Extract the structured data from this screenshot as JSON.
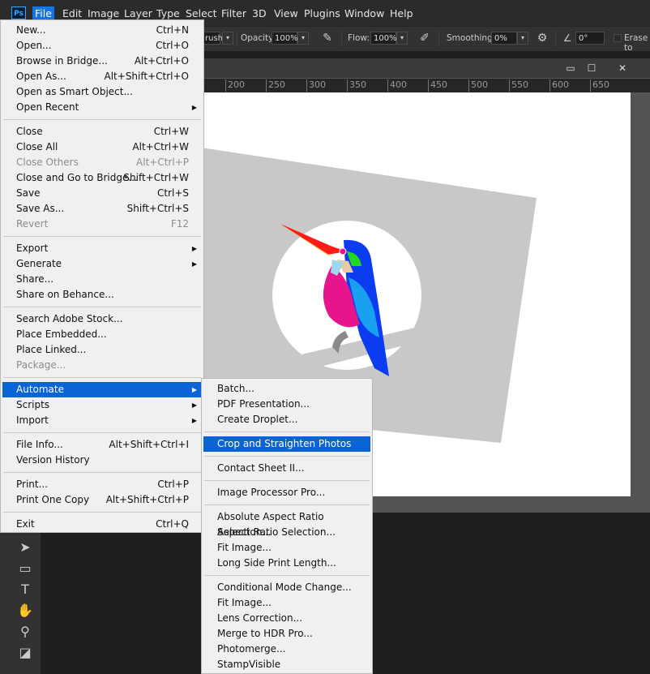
{
  "menubar": {
    "logo": "Ps",
    "menus": [
      "File",
      "Edit",
      "Image",
      "Layer",
      "Type",
      "Select",
      "Filter",
      "3D",
      "View",
      "Plugins",
      "Window",
      "Help"
    ],
    "active_menu": "File"
  },
  "options_bar": {
    "brush_fragment": "rush",
    "opacity_label": "Opacity:",
    "opacity_value": "100%",
    "flow_label": "Flow:",
    "flow_value": "100%",
    "smoothing_label": "Smoothing:",
    "smoothing_value": "0%",
    "angle_value": "0°",
    "erase_label": "Erase to"
  },
  "document_window": {
    "controls": [
      "▭",
      "☐",
      "✕"
    ],
    "ruler_ticks": [
      "200",
      "250",
      "300",
      "350",
      "400",
      "450",
      "500",
      "550",
      "600",
      "650"
    ]
  },
  "file_menu": {
    "groups": [
      [
        {
          "label": "New...",
          "shortcut": "Ctrl+N"
        },
        {
          "label": "Open...",
          "shortcut": "Ctrl+O"
        },
        {
          "label": "Browse in Bridge...",
          "shortcut": "Alt+Ctrl+O"
        },
        {
          "label": "Open As...",
          "shortcut": "Alt+Shift+Ctrl+O"
        },
        {
          "label": "Open as Smart Object...",
          "shortcut": ""
        },
        {
          "label": "Open Recent",
          "shortcut": "",
          "submenu": true
        }
      ],
      [
        {
          "label": "Close",
          "shortcut": "Ctrl+W"
        },
        {
          "label": "Close All",
          "shortcut": "Alt+Ctrl+W"
        },
        {
          "label": "Close Others",
          "shortcut": "Alt+Ctrl+P",
          "disabled": true
        },
        {
          "label": "Close and Go to Bridge...",
          "shortcut": "Shift+Ctrl+W"
        },
        {
          "label": "Save",
          "shortcut": "Ctrl+S"
        },
        {
          "label": "Save As...",
          "shortcut": "Shift+Ctrl+S"
        },
        {
          "label": "Revert",
          "shortcut": "F12",
          "disabled": true
        }
      ],
      [
        {
          "label": "Export",
          "shortcut": "",
          "submenu": true
        },
        {
          "label": "Generate",
          "shortcut": "",
          "submenu": true
        },
        {
          "label": "Share...",
          "shortcut": ""
        },
        {
          "label": "Share on Behance...",
          "shortcut": ""
        }
      ],
      [
        {
          "label": "Search Adobe Stock...",
          "shortcut": ""
        },
        {
          "label": "Place Embedded...",
          "shortcut": ""
        },
        {
          "label": "Place Linked...",
          "shortcut": ""
        },
        {
          "label": "Package...",
          "shortcut": "",
          "disabled": true
        }
      ],
      [
        {
          "label": "Automate",
          "shortcut": "",
          "submenu": true,
          "highlighted": true
        },
        {
          "label": "Scripts",
          "shortcut": "",
          "submenu": true
        },
        {
          "label": "Import",
          "shortcut": "",
          "submenu": true
        }
      ],
      [
        {
          "label": "File Info...",
          "shortcut": "Alt+Shift+Ctrl+I"
        },
        {
          "label": "Version History",
          "shortcut": ""
        }
      ],
      [
        {
          "label": "Print...",
          "shortcut": "Ctrl+P"
        },
        {
          "label": "Print One Copy",
          "shortcut": "Alt+Shift+Ctrl+P"
        }
      ],
      [
        {
          "label": "Exit",
          "shortcut": "Ctrl+Q"
        }
      ]
    ]
  },
  "automate_submenu": {
    "groups": [
      [
        {
          "label": "Batch..."
        },
        {
          "label": "PDF Presentation..."
        },
        {
          "label": "Create Droplet..."
        }
      ],
      [
        {
          "label": "Crop and Straighten Photos",
          "highlighted": true
        }
      ],
      [
        {
          "label": "Contact Sheet II..."
        }
      ],
      [
        {
          "label": "Image Processor Pro..."
        }
      ],
      [
        {
          "label": "Absolute Aspect Ratio Selection..."
        },
        {
          "label": "Aspect Ratio Selection..."
        },
        {
          "label": "Fit Image..."
        },
        {
          "label": "Long Side Print Length..."
        }
      ],
      [
        {
          "label": "Conditional Mode Change..."
        },
        {
          "label": "Fit Image..."
        },
        {
          "label": "Lens Correction..."
        },
        {
          "label": "Merge to HDR Pro..."
        },
        {
          "label": "Photomerge..."
        },
        {
          "label": "StampVisible"
        }
      ]
    ]
  },
  "toolbar": {
    "tools": [
      "move-icon",
      "rectangle-marquee-icon",
      "type-icon",
      "hand-icon",
      "zoom-icon",
      "default-colors-icon"
    ]
  },
  "colors": {
    "highlight": "#0a64d6",
    "menubar_bg": "#2b2b2b",
    "menu_bg": "#f0f0f0",
    "canvas_bg": "#ffffff",
    "bird_blue": "#0c3cf0",
    "bird_pink": "#e6158c",
    "bird_cyan": "#1aa0f0",
    "bird_green": "#22d822",
    "bird_beak": "#ff1a1a"
  }
}
